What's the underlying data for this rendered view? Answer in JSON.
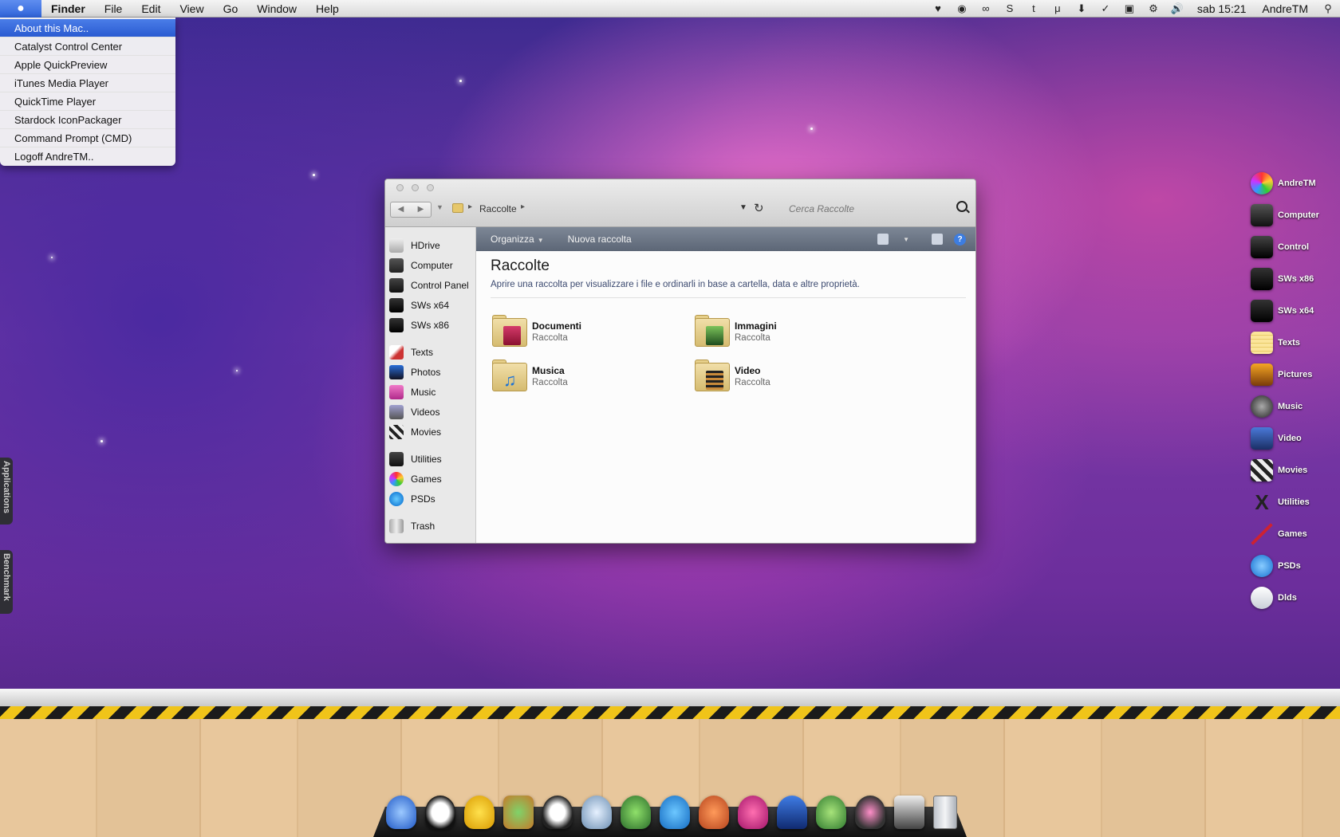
{
  "menubar": {
    "app": "Finder",
    "menus": [
      "File",
      "Edit",
      "View",
      "Go",
      "Window",
      "Help"
    ],
    "clock": "sab 15:21",
    "user": "AndreTM",
    "status_icons": [
      "heart-icon",
      "record-icon",
      "link-icon",
      "skype-icon",
      "tumblr-icon",
      "mu-icon",
      "download-icon",
      "check-icon",
      "camera-icon",
      "gear-icon",
      "volume-icon"
    ]
  },
  "apple_menu": {
    "items": [
      "About this Mac..",
      "Catalyst Control Center",
      "Apple QuickPreview",
      "iTunes Media Player",
      "QuickTime Player",
      "Stardock IconPackager",
      "Command Prompt (CMD)",
      "Logoff AndreTM.."
    ],
    "active_index": 0
  },
  "window": {
    "address": "Raccolte",
    "search_placeholder": "Cerca Raccolte",
    "toolbar": {
      "organize": "Organizza",
      "new_library": "Nuova raccolta"
    },
    "sidebar": {
      "group1": [
        "HDrive",
        "Computer",
        "Control Panel",
        "SWs x64",
        "SWs x86"
      ],
      "group2": [
        "Texts",
        "Photos",
        "Music",
        "Videos",
        "Movies"
      ],
      "group3": [
        "Utilities",
        "Games",
        "PSDs"
      ],
      "group4": [
        "Trash"
      ]
    },
    "title": "Raccolte",
    "description": "Aprire una raccolta per visualizzare i file e ordinarli in base a cartella, data e altre proprietà.",
    "libraries": [
      {
        "name": "Documenti",
        "type": "Raccolta"
      },
      {
        "name": "Immagini",
        "type": "Raccolta"
      },
      {
        "name": "Musica",
        "type": "Raccolta"
      },
      {
        "name": "Video",
        "type": "Raccolta"
      }
    ]
  },
  "desktop_icons": [
    "AndreTM",
    "Computer",
    "Control",
    "SWs x86",
    "SWs x64",
    "Texts",
    "Pictures",
    "Music",
    "Video",
    "Movies",
    "Utilities",
    "Games",
    "PSDs",
    "Dlds"
  ],
  "side_tabs": {
    "applications": "Applications",
    "benchmark": "Benchmark"
  }
}
